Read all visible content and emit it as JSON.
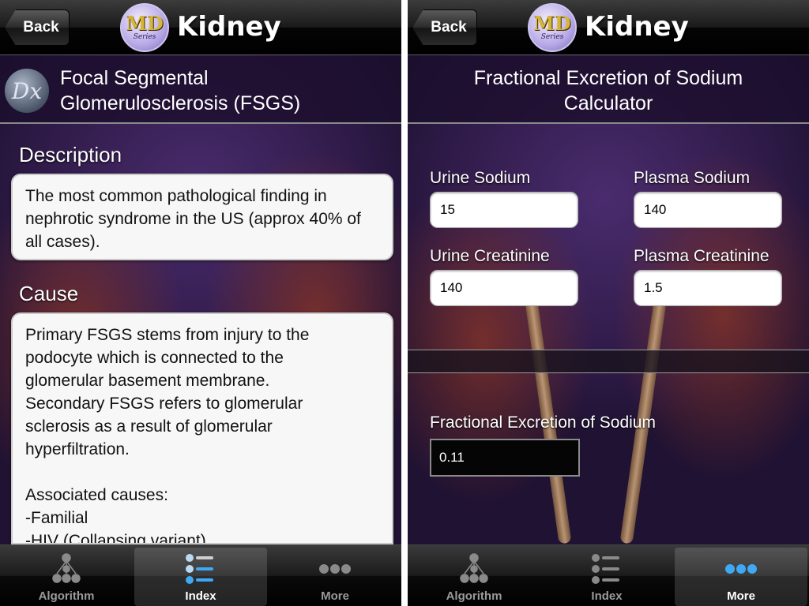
{
  "left_screen": {
    "nav": {
      "back_label": "Back",
      "logo_letters": "MD",
      "logo_series": "Series",
      "title": "Kidney"
    },
    "header": {
      "icon_text": "Dx",
      "title_line1": "Focal Segmental",
      "title_line2": "Glomerulosclerosis (FSGS)"
    },
    "sections": {
      "description_heading": "Description",
      "description_text": "The most common pathological finding in nephrotic syndrome in the US (approx 40% of all cases).",
      "cause_heading": "Cause",
      "cause_lines": [
        "Primary FSGS stems from injury to the",
        "podocyte which is connected to the",
        "glomerular basement membrane.",
        "Secondary FSGS refers to glomerular",
        "sclerosis as a result of glomerular",
        "hyperfiltration.",
        "",
        "Associated causes:",
        "-Familial",
        "-HIV (Collapsing variant)"
      ]
    },
    "tabbar": {
      "tabs": [
        {
          "label": "Algorithm",
          "icon": "tree-icon",
          "active": false
        },
        {
          "label": "Index",
          "icon": "list-icon",
          "active": true
        },
        {
          "label": "More",
          "icon": "more-dots-icon",
          "active": false
        }
      ]
    }
  },
  "right_screen": {
    "nav": {
      "back_label": "Back",
      "logo_letters": "MD",
      "logo_series": "Series",
      "title": "Kidney"
    },
    "header": {
      "title_line1": "Fractional Excretion of Sodium",
      "title_line2": "Calculator"
    },
    "calculator": {
      "urine_sodium_label": "Urine Sodium",
      "urine_sodium_value": "15",
      "plasma_sodium_label": "Plasma Sodium",
      "plasma_sodium_value": "140",
      "urine_creatinine_label": "Urine Creatinine",
      "urine_creatinine_value": "140",
      "plasma_creatinine_label": "Plasma Creatinine",
      "plasma_creatinine_value": "1.5",
      "result_label": "Fractional Excretion of Sodium",
      "result_value": "0.11"
    },
    "tabbar": {
      "tabs": [
        {
          "label": "Algorithm",
          "icon": "tree-icon",
          "active": false
        },
        {
          "label": "Index",
          "icon": "list-icon",
          "active": false
        },
        {
          "label": "More",
          "icon": "more-dots-icon",
          "active": true
        }
      ]
    }
  },
  "colors": {
    "nav_bg": "#000000",
    "purple_bg": "#2e1a47",
    "active_accent": "#3fa9f5"
  }
}
